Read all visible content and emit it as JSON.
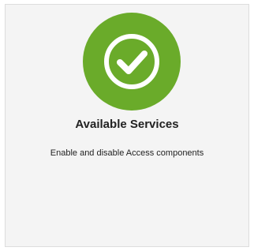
{
  "card": {
    "title": "Available Services",
    "description": "Enable and disable Access components",
    "icon": "check-circle-icon",
    "icon_color": "#6aab2a"
  }
}
